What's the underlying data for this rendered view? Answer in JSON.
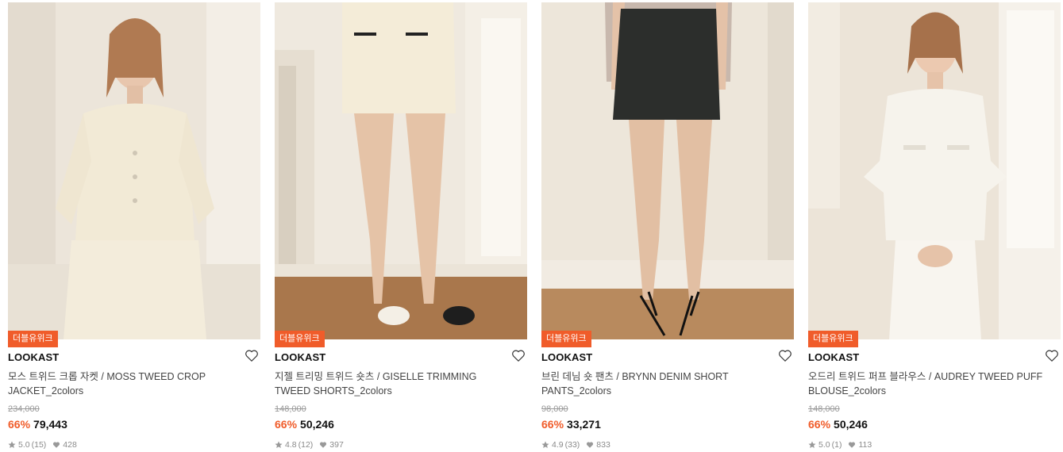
{
  "products": [
    {
      "badge": "더블유위크",
      "brand": "LOOKAST",
      "name": "모스 트위드 크롭 자켓 / MOSS TWEED CROP JACKET_2colors",
      "original_price": "234,000",
      "discount": "66%",
      "price": "79,443",
      "rating": "5.0",
      "reviews": "(15)",
      "likes": "428",
      "image": "woman-tweed-jacket-photo"
    },
    {
      "badge": "더블유위크",
      "brand": "LOOKAST",
      "name": "지젤 트리밍 트위드 숏츠 / GISELLE TRIMMING TWEED SHORTS_2colors",
      "original_price": "148,000",
      "discount": "66%",
      "price": "50,246",
      "rating": "4.8",
      "reviews": "(12)",
      "likes": "397",
      "image": "tweed-shorts-photo"
    },
    {
      "badge": "더블유위크",
      "brand": "LOOKAST",
      "name": "브린 데님 숏 팬츠 / BRYNN DENIM SHORT PANTS_2colors",
      "original_price": "98,000",
      "discount": "66%",
      "price": "33,271",
      "rating": "4.9",
      "reviews": "(33)",
      "likes": "833",
      "image": "denim-shorts-photo"
    },
    {
      "badge": "더블유위크",
      "brand": "LOOKAST",
      "name": "오드리 트위드 퍼프 블라우스 / AUDREY TWEED PUFF BLOUSE_2colors",
      "original_price": "148,000",
      "discount": "66%",
      "price": "50,246",
      "rating": "5.0",
      "reviews": "(1)",
      "likes": "113",
      "image": "woman-tweed-blouse-photo"
    }
  ],
  "colors": {
    "badge": "#f05c2a",
    "discount": "#f05c2a",
    "muted": "#8a8a8a"
  }
}
